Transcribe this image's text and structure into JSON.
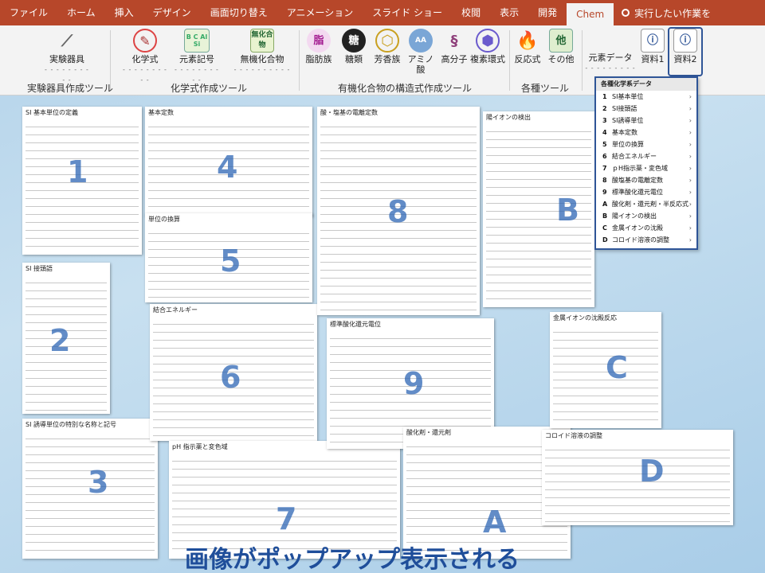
{
  "ribbon_tabs": [
    "ファイル",
    "ホーム",
    "挿入",
    "デザイン",
    "画面切り替え",
    "アニメーション",
    "スライド ショー",
    "校閲",
    "表示",
    "開発",
    "Chem"
  ],
  "search_label": "実行したい作業を",
  "buttons": {
    "jikken": "実験器具",
    "kagakushiki": "化学式",
    "genso": "元素記号",
    "muki": "無機化合物",
    "shibo": "脂肪族",
    "torui": "糖類",
    "hoko": "芳香族",
    "amino": "アミノ酸",
    "kobunshi": "高分子",
    "fukusokan": "複素環式",
    "hanno": "反応式",
    "sonota": "その他",
    "genso_data": "元素データ",
    "shiryo1": "資料1",
    "shiryo2": "資料2"
  },
  "icon_text": {
    "genso": "B C Al Si",
    "muki": "無化合物",
    "shibo": "脂",
    "torui": "糖",
    "sonota": "他"
  },
  "groups": {
    "g1": "実験器具作成ツール",
    "g2": "化学式作成ツール",
    "g3": "有機化合物の構造式作成ツール",
    "g4": "各種ツール"
  },
  "dropdown": {
    "title": "各種化学系データ",
    "items": [
      {
        "key": "1",
        "label": "SI基本単位"
      },
      {
        "key": "2",
        "label": "SI接頭語"
      },
      {
        "key": "3",
        "label": "SI誘導単位"
      },
      {
        "key": "4",
        "label": "基本定数"
      },
      {
        "key": "5",
        "label": "単位の換算"
      },
      {
        "key": "6",
        "label": "結合エネルギー"
      },
      {
        "key": "7",
        "label": "ｐH指示薬・変色域"
      },
      {
        "key": "8",
        "label": "酸塩基の電離定数"
      },
      {
        "key": "9",
        "label": "標準酸化還元電位"
      },
      {
        "key": "A",
        "label": "酸化剤・還元剤・半反応式"
      },
      {
        "key": "B",
        "label": "陽イオンの検出"
      },
      {
        "key": "C",
        "label": "金属イオンの沈殿"
      },
      {
        "key": "D",
        "label": "コロイド溶液の調整"
      }
    ]
  },
  "cards": {
    "c1": "SI 基本単位の定義",
    "c2": "SI 接頭語",
    "c3": "SI 誘導単位の特別な名称と記号",
    "c4": "基本定数",
    "c5": "単位の換算",
    "c6": "結合エネルギー",
    "c7": "pH 指示薬と変色域",
    "c8": "酸・塩基の電離定数",
    "c9": "標準酸化還元電位",
    "cA": "酸化剤・還元剤",
    "cB": "陽イオンの検出",
    "cC": "金属イオンの沈殿反応",
    "cD": "コロイド溶液の調整"
  },
  "markers": [
    "1",
    "2",
    "3",
    "4",
    "5",
    "6",
    "7",
    "8",
    "9",
    "A",
    "B",
    "C",
    "D"
  ],
  "caption": "画像がポップアップ表示される",
  "colors": {
    "tab_bar": "#b7472a",
    "accent": "#2f5597",
    "marker": "#2e66b5",
    "background": "#b4d3ea"
  }
}
